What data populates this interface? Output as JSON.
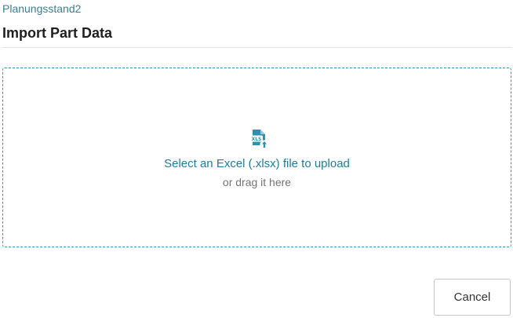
{
  "header": {
    "breadcrumb": "Planungsstand2",
    "title": "Import Part Data"
  },
  "dropzone": {
    "icon": "xls-file-upload-icon",
    "primary_text": "Select an Excel (.xlsx) file to upload",
    "secondary_text": "or drag it here",
    "icon_label": "XLS"
  },
  "footer": {
    "cancel_label": "Cancel"
  },
  "colors": {
    "accent": "#1d7d99",
    "dropzone_border": "#2a95b5",
    "breadcrumb": "#3a7f8f"
  }
}
